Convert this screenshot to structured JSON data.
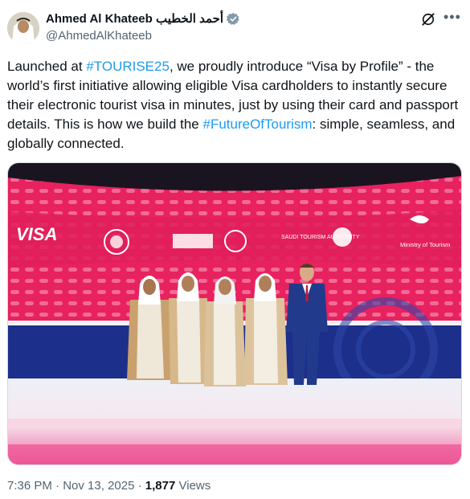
{
  "author": {
    "name": "Ahmed Al Khateeb أحمد الخطيب",
    "handle": "@AhmedAlKhateeb"
  },
  "tweet": {
    "part1": "Launched at ",
    "tag1": "#TOURISE25",
    "part2": ", we proudly introduce “Visa by Profile” - the world’s first initiative allowing eligible Visa cardholders to instantly secure their electronic tourist visa in minutes, just by using their card and passport details. This is how we build the ",
    "tag2": "#FutureOfTourism",
    "part3": ": simple, seamless, and globally connected."
  },
  "image": {
    "logos": {
      "visa": "VISA",
      "saudi_tourism_en": "SAUDI TOURISM AUTHORITY",
      "ministry_en": "Ministry of Tourism"
    }
  },
  "meta": {
    "time": "7:36 PM",
    "separator": "·",
    "date": "Nov 13, 2025",
    "views_count": "1,877",
    "views_label": "Views"
  },
  "colors": {
    "link": "#1d9bf0",
    "screen_pink": "#e11d5b",
    "stage_blue": "#1c2f8a"
  }
}
